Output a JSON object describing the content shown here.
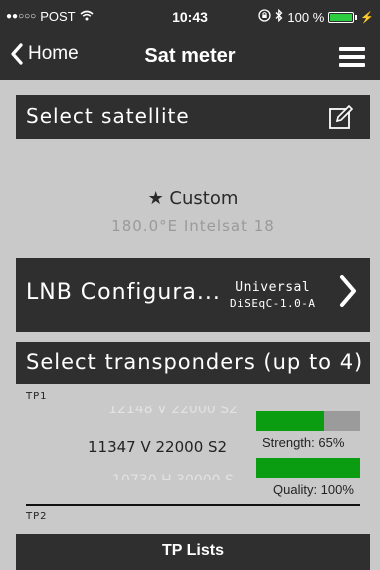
{
  "status_bar": {
    "carrier": "POST",
    "time": "10:43",
    "battery_text": "100 %"
  },
  "nav": {
    "back_label": "Home",
    "title": "Sat meter"
  },
  "select_satellite": {
    "label": "Select satellite"
  },
  "satellite": {
    "name": "★ Custom",
    "position": "180.0°E Intelsat 18"
  },
  "lnb": {
    "label": "LNB Configura...",
    "type": "Universal",
    "diseqc": "DiSEqC-1.0-A"
  },
  "transponders": {
    "label": "Select transponders (up to 4)",
    "tp1_label": "TP1",
    "tp2_label": "TP2",
    "prev": "12148 V 22000 S2",
    "current": "11347 V 22000 S2",
    "next": "10730 H 30000 S"
  },
  "signal": {
    "strength_label": "Strength: 65%",
    "strength": 0.65,
    "quality_label": "Quality: 100%",
    "quality": 1.0
  },
  "footer": {
    "tp_lists": "TP Lists"
  },
  "colors": {
    "bar_fill": "#0a9d12",
    "bar_bg": "#9b9b9b",
    "panel": "#2f2f2f",
    "background": "#c9c9c9"
  }
}
